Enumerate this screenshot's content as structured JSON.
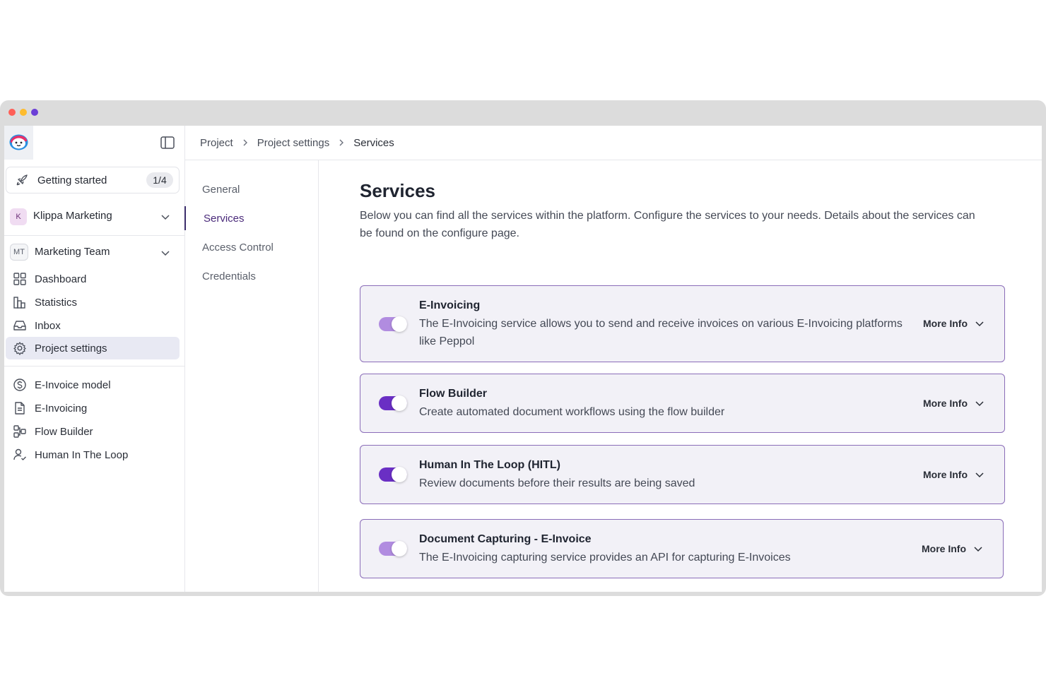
{
  "window": {
    "dots": [
      "red",
      "yellow",
      "purple"
    ]
  },
  "sidebar": {
    "getting_started": {
      "label": "Getting started",
      "badge": "1/4"
    },
    "org": {
      "initial": "K",
      "name": "Klippa Marketing"
    },
    "team": {
      "initials": "MT",
      "name": "Marketing Team"
    },
    "nav": [
      {
        "label": "Dashboard",
        "icon": "grid-icon"
      },
      {
        "label": "Statistics",
        "icon": "bar-chart-icon"
      },
      {
        "label": "Inbox",
        "icon": "inbox-icon"
      },
      {
        "label": "Project settings",
        "icon": "gear-icon",
        "active": true
      }
    ],
    "services": [
      {
        "label": "E-Invoice model",
        "icon": "dollar-circle-icon"
      },
      {
        "label": "E-Invoicing",
        "icon": "document-icon"
      },
      {
        "label": "Flow Builder",
        "icon": "flow-icon"
      },
      {
        "label": "Human In The Loop",
        "icon": "user-check-icon"
      }
    ]
  },
  "breadcrumb": [
    "Project",
    "Project settings",
    "Services"
  ],
  "subnav": [
    "General",
    "Services",
    "Access Control",
    "Credentials"
  ],
  "main": {
    "title": "Services",
    "description": "Below you can find all the services within the platform. Configure the services to your needs. Details about the services can be found on the configure page.",
    "more_info_label": "More Info",
    "cards": [
      {
        "title": "E-Invoicing",
        "description": "The E-Invoicing service allows you to send and receive invoices on various E-Invoicing platforms like Peppol",
        "toggle_color": "#b18ce0"
      },
      {
        "title": "Flow Builder",
        "description": "Create automated document workflows using the flow builder",
        "toggle_color": "#6a2fc4"
      },
      {
        "title": "Human In The Loop (HITL)",
        "description": "Review documents before their results are being saved",
        "toggle_color": "#6a2fc4"
      },
      {
        "title": "Document Capturing - E-Invoice",
        "description": "The E-Invoicing capturing service provides an API for capturing E-Invoices",
        "toggle_color": "#b18ce0"
      }
    ]
  }
}
